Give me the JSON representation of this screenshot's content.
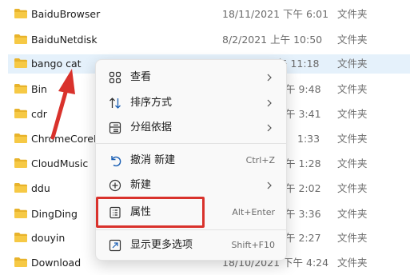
{
  "file_list": {
    "rows": [
      {
        "name": "BaiduBrowser",
        "date": "18/11/2021 下午 6:01",
        "type": "文件夹",
        "selected": false
      },
      {
        "name": "BaiduNetdisk",
        "date": "8/2/2021 上午 10:50",
        "type": "文件夹",
        "selected": false
      },
      {
        "name": "bango cat",
        "date": "午 11:18",
        "type": "文件夹",
        "selected": true
      },
      {
        "name": "Bin",
        "date": "午 9:48",
        "type": "文件夹",
        "selected": false
      },
      {
        "name": "cdr",
        "date": "午 3:41",
        "type": "文件夹",
        "selected": false
      },
      {
        "name": "ChromeCoreD",
        "date": "1:33",
        "type": "文件夹",
        "selected": false
      },
      {
        "name": "CloudMusic",
        "date": "午 1:28",
        "type": "文件夹",
        "selected": false
      },
      {
        "name": "ddu",
        "date": "午 2:02",
        "type": "文件夹",
        "selected": false
      },
      {
        "name": "DingDing",
        "date": "午 3:36",
        "type": "文件夹",
        "selected": false
      },
      {
        "name": "douyin",
        "date": "午 2:27",
        "type": "文件夹",
        "selected": false
      },
      {
        "name": "Download",
        "date": "18/10/2021 下午 4:24",
        "type": "文件夹",
        "selected": false
      }
    ]
  },
  "context_menu": {
    "items": [
      {
        "label": "查看",
        "shortcut": "",
        "has_submenu": true,
        "icon": "grid-view-icon"
      },
      {
        "label": "排序方式",
        "shortcut": "",
        "has_submenu": true,
        "icon": "sort-icon"
      },
      {
        "label": "分组依据",
        "shortcut": "",
        "has_submenu": true,
        "icon": "group-by-icon"
      },
      {
        "label": "撤消 新建",
        "shortcut": "Ctrl+Z",
        "has_submenu": false,
        "icon": "undo-icon"
      },
      {
        "label": "新建",
        "shortcut": "",
        "has_submenu": true,
        "icon": "new-plus-icon"
      },
      {
        "label": "属性",
        "shortcut": "Alt+Enter",
        "has_submenu": false,
        "icon": "properties-icon"
      },
      {
        "label": "显示更多选项",
        "shortcut": "Shift+F10",
        "has_submenu": false,
        "icon": "show-more-options-icon"
      }
    ]
  },
  "colors": {
    "folder": "#f4c430",
    "selection": "#e5f1fb",
    "annotation_red": "#d9322c",
    "menu_icon_blue": "#1a5fb4"
  }
}
